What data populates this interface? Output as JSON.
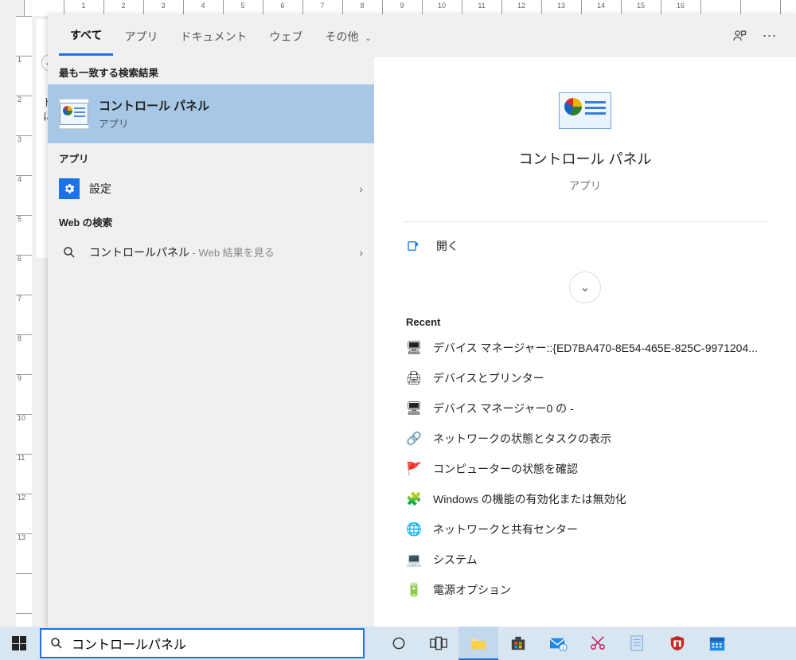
{
  "bg": {
    "back_hint": "←",
    "doc_line1": "ド",
    "doc_line2": "に",
    "h_ticks": [
      "1",
      "2",
      "3",
      "4",
      "5",
      "6",
      "7",
      "8",
      "9",
      "10",
      "11",
      "12",
      "13",
      "14",
      "15",
      "16"
    ],
    "v_ticks": [
      "1",
      "2",
      "3",
      "4",
      "5",
      "6",
      "7",
      "8",
      "9",
      "10",
      "11",
      "12",
      "13"
    ]
  },
  "tabs": {
    "all": "すべて",
    "apps": "アプリ",
    "documents": "ドキュメント",
    "web": "ウェブ",
    "more": "その他"
  },
  "sections": {
    "best": "最も一致する検索結果",
    "apps": "アプリ",
    "web": "Web の検索"
  },
  "best_match": {
    "title": "コントロール パネル",
    "subtitle": "アプリ"
  },
  "apps_list": {
    "settings": "設定"
  },
  "web_list": {
    "cp_query": "コントロールパネル",
    "cp_suffix": " - Web 結果を見る"
  },
  "preview": {
    "title": "コントロール パネル",
    "subtitle": "アプリ",
    "open": "開く",
    "recent_label": "Recent",
    "recent": [
      {
        "icon": "🖥",
        "text": "デバイス マネージャー::{ED7BA470-8E54-465E-825C-9971204..."
      },
      {
        "icon": "🖨",
        "text": "デバイスとプリンター"
      },
      {
        "icon": "🖥",
        "text": "デバイス マネージャー0 の -"
      },
      {
        "icon": "🔗",
        "text": "ネットワークの状態とタスクの表示"
      },
      {
        "icon": "🚩",
        "text": "コンピューターの状態を確認"
      },
      {
        "icon": "🧩",
        "text": "Windows の機能の有効化または無効化"
      },
      {
        "icon": "🌐",
        "text": "ネットワークと共有センター"
      },
      {
        "icon": "💻",
        "text": "システム"
      },
      {
        "icon": "🔋",
        "text": "電源オプション"
      }
    ]
  },
  "taskbar": {
    "search_value": "コントロールパネル"
  }
}
